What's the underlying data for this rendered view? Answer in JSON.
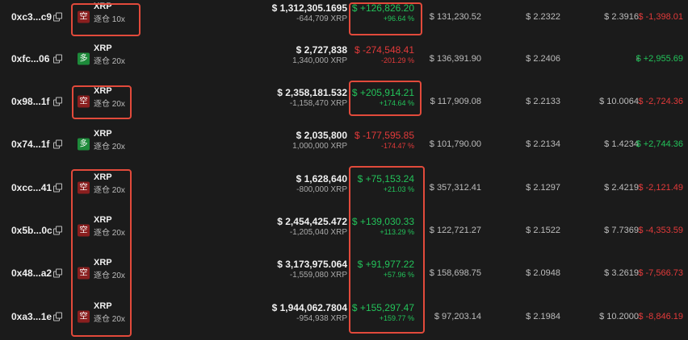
{
  "rows": [
    {
      "address": "0xc3...c9",
      "side_icon": "空",
      "side": "short",
      "symbol": "XRP",
      "leverage": "逐仓 10x",
      "position_value": "$ 1,312,305.1695",
      "size": "-644,709 XRP",
      "pnl": "$ +126,826.20",
      "pnl_pct": "+96.64 %",
      "pnl_color": "green",
      "margin": "$ 131,230.52",
      "entry_price": "$ 2.2322",
      "liq_price": "$ 2.3916",
      "funding": "$ -1,398.01",
      "funding_color": "red"
    },
    {
      "address": "0xfc...06",
      "side_icon": "多",
      "side": "long",
      "symbol": "XRP",
      "leverage": "逐仓 20x",
      "position_value": "$ 2,727,838",
      "size": "1,340,000 XRP",
      "pnl": "$ -274,548.41",
      "pnl_pct": "-201.29 %",
      "pnl_color": "red",
      "margin": "$ 136,391.90",
      "entry_price": "$ 2.2406",
      "liq_price": "-",
      "funding": "$ +2,955.69",
      "funding_color": "green"
    },
    {
      "address": "0x98...1f",
      "side_icon": "空",
      "side": "short",
      "symbol": "XRP",
      "leverage": "逐仓 20x",
      "position_value": "$ 2,358,181.532",
      "size": "-1,158,470 XRP",
      "pnl": "$ +205,914.21",
      "pnl_pct": "+174.64 %",
      "pnl_color": "green",
      "margin": "$ 117,909.08",
      "entry_price": "$ 2.2133",
      "liq_price": "$ 10.0064",
      "funding": "$ -2,724.36",
      "funding_color": "red"
    },
    {
      "address": "0x74...1f",
      "side_icon": "多",
      "side": "long",
      "symbol": "XRP",
      "leverage": "逐仓 20x",
      "position_value": "$ 2,035,800",
      "size": "1,000,000 XRP",
      "pnl": "$ -177,595.85",
      "pnl_pct": "-174.47 %",
      "pnl_color": "red",
      "margin": "$ 101,790.00",
      "entry_price": "$ 2.2134",
      "liq_price": "$ 1.4234",
      "funding": "$ +2,744.36",
      "funding_color": "green"
    },
    {
      "address": "0xcc...41",
      "side_icon": "空",
      "side": "short",
      "symbol": "XRP",
      "leverage": "逐仓 20x",
      "position_value": "$ 1,628,640",
      "size": "-800,000 XRP",
      "pnl": "$ +75,153.24",
      "pnl_pct": "+21.03 %",
      "pnl_color": "green",
      "margin": "$ 357,312.41",
      "entry_price": "$ 2.1297",
      "liq_price": "$ 2.4219",
      "funding": "$ -2,121.49",
      "funding_color": "red"
    },
    {
      "address": "0x5b...0c",
      "side_icon": "空",
      "side": "short",
      "symbol": "XRP",
      "leverage": "逐仓 20x",
      "position_value": "$ 2,454,425.472",
      "size": "-1,205,040 XRP",
      "pnl": "$ +139,030.33",
      "pnl_pct": "+113.29 %",
      "pnl_color": "green",
      "margin": "$ 122,721.27",
      "entry_price": "$ 2.1522",
      "liq_price": "$ 7.7369",
      "funding": "$ -4,353.59",
      "funding_color": "red"
    },
    {
      "address": "0x48...a2",
      "side_icon": "空",
      "side": "short",
      "symbol": "XRP",
      "leverage": "逐仓 20x",
      "position_value": "$ 3,173,975.064",
      "size": "-1,559,080 XRP",
      "pnl": "$ +91,977.22",
      "pnl_pct": "+57.96 %",
      "pnl_color": "green",
      "margin": "$ 158,698.75",
      "entry_price": "$ 2.0948",
      "liq_price": "$ 3.2619",
      "funding": "$ -7,566.73",
      "funding_color": "red"
    },
    {
      "address": "0xa3...1e",
      "side_icon": "空",
      "side": "short",
      "symbol": "XRP",
      "leverage": "逐仓 20x",
      "position_value": "$ 1,944,062.7804",
      "size": "-954,938 XRP",
      "pnl": "$ +155,297.47",
      "pnl_pct": "+159.77 %",
      "pnl_color": "green",
      "margin": "$ 97,203.14",
      "entry_price": "$ 2.1984",
      "liq_price": "$ 10.2000",
      "funding": "$ -8,846.19",
      "funding_color": "red"
    }
  ],
  "colors": {
    "green": "#23c35a",
    "red": "#e33a3a",
    "highlight": "#e24a3b",
    "background": "#1b1b1b"
  }
}
